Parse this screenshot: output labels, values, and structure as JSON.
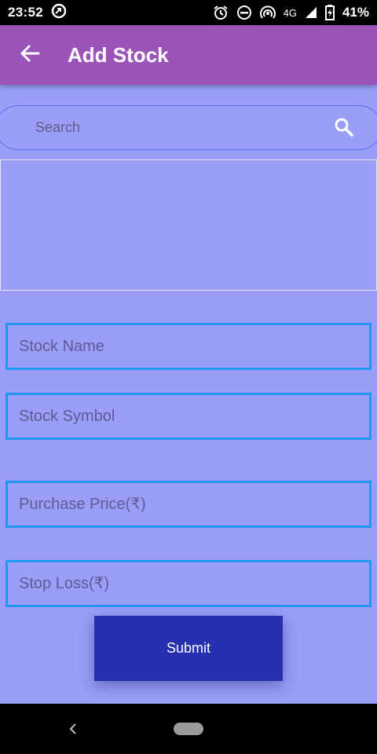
{
  "status_bar": {
    "time": "23:52",
    "network": "4G",
    "battery": "41%",
    "icons": [
      "app-notification-icon",
      "alarm-icon",
      "do-not-disturb-icon",
      "hotspot-icon",
      "signal-icon",
      "battery-icon"
    ]
  },
  "app_bar": {
    "title": "Add Stock",
    "back_icon": "arrow-left-icon",
    "color": "#9b55b8"
  },
  "search": {
    "placeholder": "Search",
    "icon": "search-icon"
  },
  "form": {
    "fields": [
      {
        "placeholder": "Stock Name"
      },
      {
        "placeholder": "Stock Symbol"
      },
      {
        "placeholder": "Purchase Price(₹)"
      },
      {
        "placeholder": "Stop Loss(₹)"
      }
    ],
    "submit_label": "Submit",
    "field_border_color": "#2196f3",
    "submit_color": "#2430b0"
  },
  "background_color": "#9a9ef8"
}
